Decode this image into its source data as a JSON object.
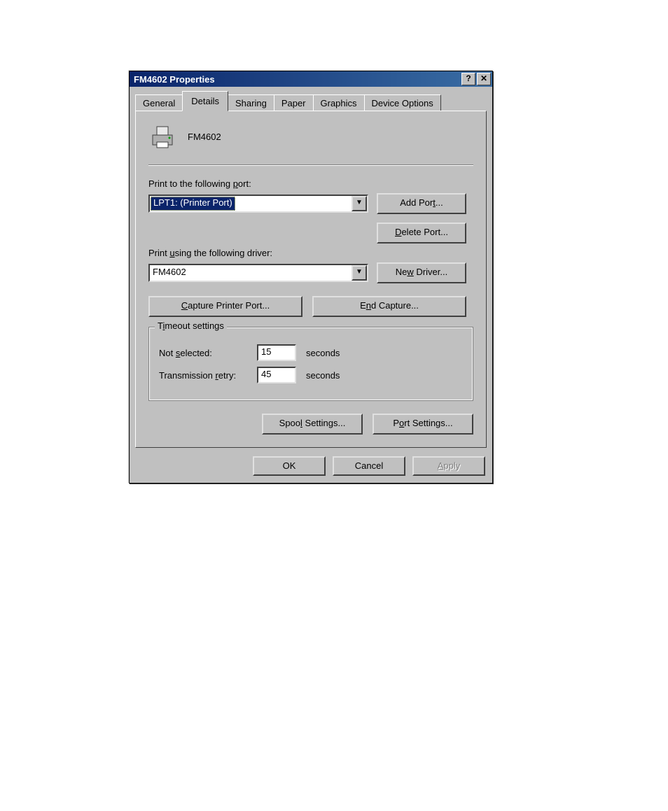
{
  "window": {
    "title": "FM4602 Properties"
  },
  "tabs": [
    {
      "label": "General"
    },
    {
      "label": "Details"
    },
    {
      "label": "Sharing"
    },
    {
      "label": "Paper"
    },
    {
      "label": "Graphics"
    },
    {
      "label": "Device Options"
    }
  ],
  "active_tab_index": 1,
  "details": {
    "printer_name": "FM4602",
    "port_label": "Print to the following port:",
    "port_value": "LPT1:  (Printer Port)",
    "driver_label": "Print using the following driver:",
    "driver_value": "FM4602",
    "buttons": {
      "add_port": "Add Port...",
      "delete_port": "Delete Port...",
      "new_driver": "New Driver...",
      "capture": "Capture Printer Port...",
      "end_capture": "End Capture...",
      "spool": "Spool Settings...",
      "port": "Port Settings..."
    },
    "timeout": {
      "legend": "Timeout settings",
      "not_sel_label": "Not selected:",
      "not_sel_value": "15",
      "retry_label": "Transmission retry:",
      "retry_value": "45",
      "unit": "seconds"
    }
  },
  "dialog_buttons": {
    "ok": "OK",
    "cancel": "Cancel",
    "apply": "Apply"
  },
  "icons": {
    "help": "?",
    "close": "✕"
  }
}
